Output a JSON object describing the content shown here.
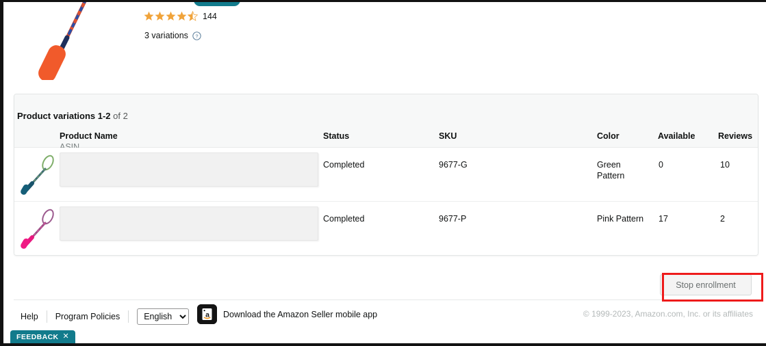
{
  "summary": {
    "rating_stars": 4.5,
    "rating_count": "144",
    "variations_text": "3 variations",
    "help_icon": "question-circle-icon",
    "hero_image_alt": "orange-handle-jump-rope"
  },
  "variations_card": {
    "title_bold": "Product variations 1-2",
    "title_light": "of 2",
    "columns": [
      {
        "label": "Product Name",
        "sub": "ASIN"
      },
      {
        "label": "Status",
        "sub": ""
      },
      {
        "label": "SKU",
        "sub": ""
      },
      {
        "label": "Color",
        "sub": ""
      },
      {
        "label": "Available",
        "sub": ""
      },
      {
        "label": "Reviews",
        "sub": ""
      }
    ],
    "rows": [
      {
        "thumb": "green-pattern-jump-rope",
        "product_name": "",
        "status": "Completed",
        "sku": "9677-G",
        "color": "Green Pattern",
        "available": "0",
        "reviews": "10"
      },
      {
        "thumb": "pink-pattern-jump-rope",
        "product_name": "",
        "status": "Completed",
        "sku": "9677-P",
        "color": "Pink Pattern",
        "available": "17",
        "reviews": "2"
      }
    ]
  },
  "actions": {
    "stop_enrollment_label": "Stop enrollment",
    "highlight_color": "#ee1b1b"
  },
  "footer": {
    "help_label": "Help",
    "program_policies_label": "Program Policies",
    "language_selected": "English",
    "language_options": [
      "English"
    ],
    "app_icon": "amazon-seller-app-icon",
    "app_text": "Download the Amazon Seller mobile app",
    "copyright": "© 1999-2023, Amazon.com, Inc. or its affiliates"
  },
  "feedback": {
    "label": "FEEDBACK",
    "close_icon": "✕",
    "color": "#127b8c"
  }
}
